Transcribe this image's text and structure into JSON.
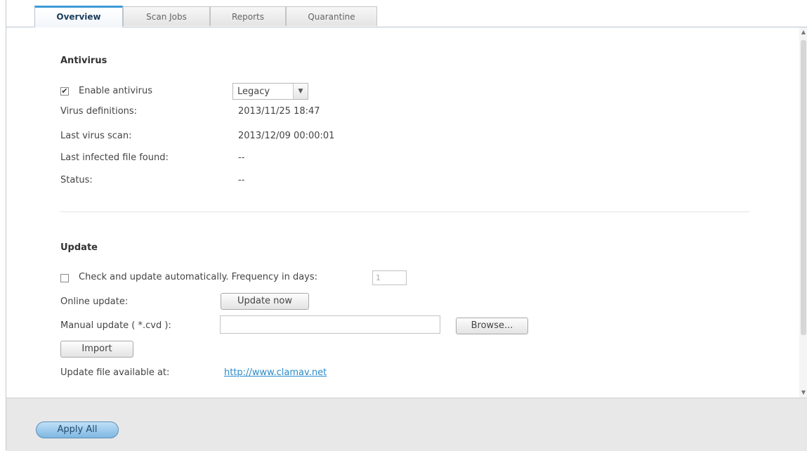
{
  "tabs": [
    {
      "label": "Overview",
      "active": true
    },
    {
      "label": "Scan Jobs",
      "active": false
    },
    {
      "label": "Reports",
      "active": false
    },
    {
      "label": "Quarantine",
      "active": false
    }
  ],
  "antivirus": {
    "title": "Antivirus",
    "enable_label": "Enable antivirus",
    "enable_checked": true,
    "engine_selected": "Legacy",
    "rows": [
      {
        "label": "Virus definitions:",
        "value": "2013/11/25 18:47"
      },
      {
        "label": "Last virus scan:",
        "value": "2013/12/09 00:00:01"
      },
      {
        "label": "Last infected file found:",
        "value": "--"
      },
      {
        "label": "Status:",
        "value": "--"
      }
    ]
  },
  "update": {
    "title": "Update",
    "auto_label": "Check and update automatically. Frequency in days:",
    "auto_checked": false,
    "frequency_value": "1",
    "online_label": "Online update:",
    "update_now_label": "Update now",
    "manual_label": "Manual update ( *.cvd ):",
    "manual_value": "",
    "browse_label": "Browse...",
    "import_label": "Import",
    "available_label": "Update file available at:",
    "available_link": "http://www.clamav.net"
  },
  "footer": {
    "apply_all_label": "Apply All"
  },
  "colors": {
    "accent": "#3d9ad6",
    "link": "#2c8bc8",
    "apply_button": "#7fb7e2"
  }
}
